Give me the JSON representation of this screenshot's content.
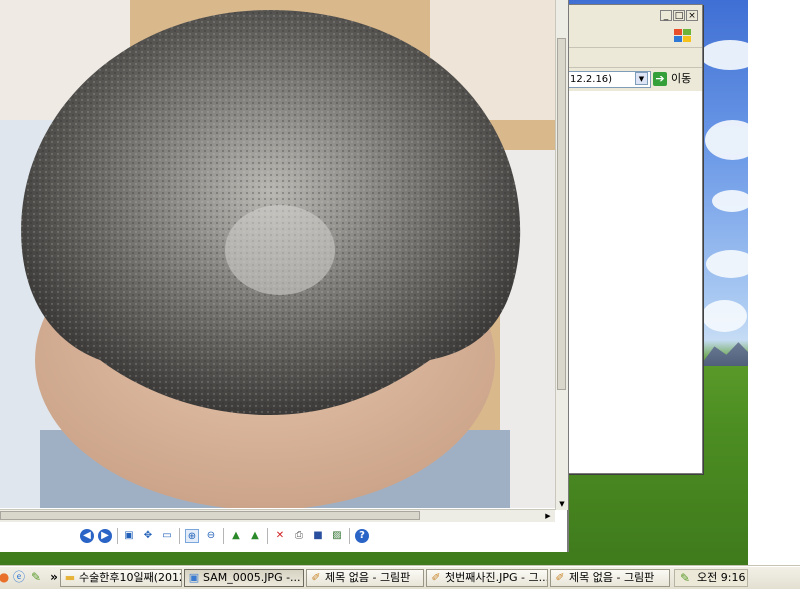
{
  "explorer": {
    "window_controls": [
      "_",
      "□",
      "×"
    ],
    "address_value": "12.2.16)",
    "go_label": "이동"
  },
  "viewer": {
    "photo_description_alt": "",
    "toolbar_icons": [
      "prev-icon",
      "next-icon",
      "fit-icon",
      "actual-size-icon",
      "slideshow-icon",
      "zoom-in-icon",
      "zoom-out-icon",
      "rotate-cw-icon",
      "rotate-ccw-icon",
      "delete-icon",
      "print-icon",
      "save-icon",
      "edit-icon",
      "help-icon"
    ]
  },
  "taskbar": {
    "quick_launch_icons": [
      "firefox-icon",
      "ie-icon",
      "pencil-icon"
    ],
    "chevron": "»",
    "tasks": [
      {
        "label": "수술한후10일째(2012...",
        "icon": "folder-icon"
      },
      {
        "label": "SAM_0005.JPG -...",
        "icon": "image-viewer-icon"
      },
      {
        "label": "제목 없음 - 그림판",
        "icon": "paint-icon"
      },
      {
        "label": "첫번째사진.JPG - 그...",
        "icon": "paint-icon"
      },
      {
        "label": "제목 없음 - 그림판",
        "icon": "paint-icon"
      }
    ],
    "clock": "오전 9:16"
  }
}
